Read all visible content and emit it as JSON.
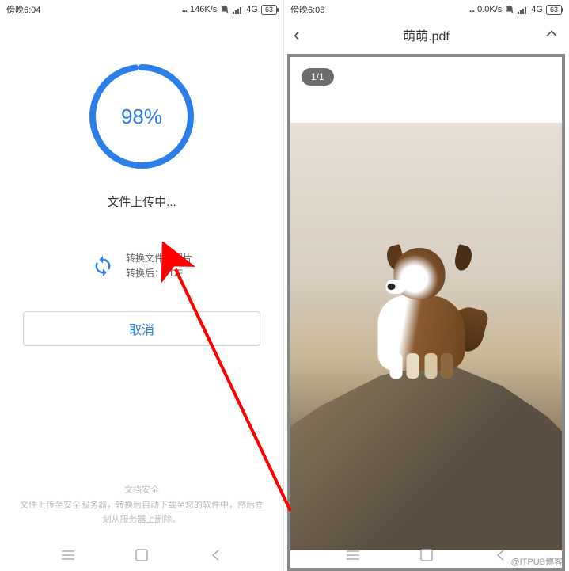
{
  "left_screen": {
    "status": {
      "time": "傍晚6:04",
      "speed": "146K/s",
      "network": "4G",
      "battery": "63"
    },
    "progress": {
      "percent": 98,
      "label": "98%"
    },
    "upload_status": "文件上传中...",
    "convert": {
      "line1": "转换文件：图片",
      "line2": "转换后：PDF"
    },
    "cancel_label": "取消",
    "security": {
      "title": "文档安全",
      "desc": "文件上传至安全服务器，转换后自动下载至您的软件中，然后立刻从服务器上删除。"
    }
  },
  "right_screen": {
    "status": {
      "time": "傍晚6:06",
      "speed": "0.0K/s",
      "network": "4G",
      "battery": "63"
    },
    "title": "萌萌.pdf",
    "page_indicator": "1/1"
  },
  "watermark": "@ITPUB博客"
}
